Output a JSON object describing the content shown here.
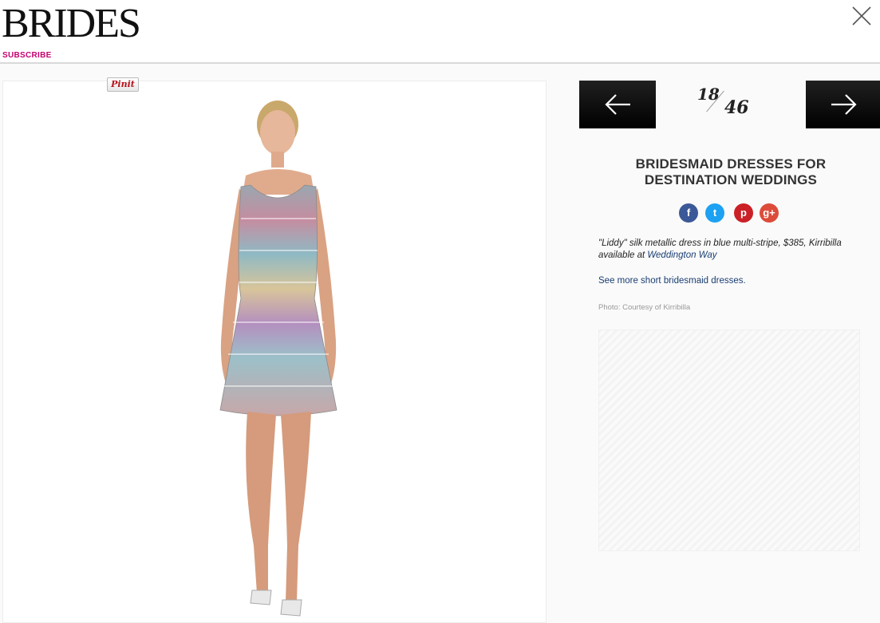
{
  "header": {
    "logo": "BRIDES",
    "subscribe": "SUBSCRIBE"
  },
  "image": {
    "pin_label": "Pinit"
  },
  "pager": {
    "current": "18",
    "total": "46"
  },
  "article": {
    "title_line1": "BRIDESMAID DRESSES FOR",
    "title_line2": "DESTINATION WEDDINGS",
    "caption_text": "\"Liddy\" silk metallic dress in blue multi-stripe, $385, Kirribilla available at ",
    "caption_link": "Weddington Way",
    "more_link": "See more short bridesmaid dresses.",
    "photo_credit": "Photo: Courtesy of Kirribilla"
  },
  "share": {
    "facebook": "f",
    "twitter": "t",
    "pinterest": "p",
    "googleplus": "g+"
  },
  "colors": {
    "brand_pink": "#c4006f",
    "link_blue": "#1a3e73",
    "facebook": "#3b5998",
    "twitter": "#1da1f2",
    "pinterest": "#cb2027",
    "googleplus": "#dd4b39"
  }
}
